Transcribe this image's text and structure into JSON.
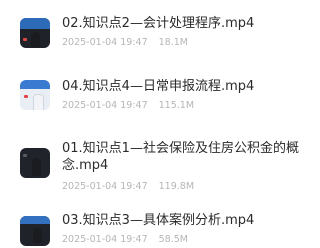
{
  "files": [
    {
      "title": "02.知识点2—会计处理程序.mp4",
      "datetime": "2025-01-04 19:47",
      "size": "18.1M",
      "thumb_icon": "video-thumbnail"
    },
    {
      "title": "04.知识点4—日常申报流程.mp4",
      "datetime": "2025-01-04 19:47",
      "size": "115.1M",
      "thumb_icon": "video-thumbnail"
    },
    {
      "title": "01.知识点1—社会保险及住房公积金的概念.mp4",
      "datetime": "2025-01-04 19:47",
      "size": "119.8M",
      "thumb_icon": "video-thumbnail"
    },
    {
      "title": "03.知识点3—具体案例分析.mp4",
      "datetime": "2025-01-04 19:47",
      "size": "58.5M",
      "thumb_icon": "video-thumbnail"
    }
  ],
  "colors": {
    "title": "#2b2b2b",
    "meta": "#b6b6b6",
    "background": "#ffffff"
  }
}
